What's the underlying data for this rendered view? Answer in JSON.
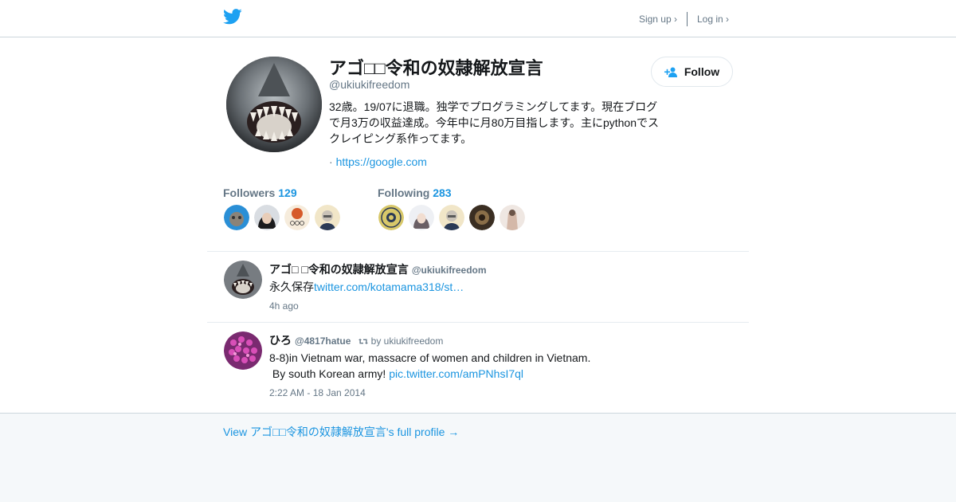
{
  "header": {
    "signup_label": "Sign up ›",
    "login_label": "Log in ›"
  },
  "profile": {
    "name": "アゴ□□令和の奴隷解放宣言",
    "handle": "@ukiukifreedom",
    "bio": "32歳。19/07に退職。独学でプログラミングしてます。現在ブログで月3万の収益達成。今年中に月80万目指します。主にpythonでスクレイピング系作ってます。",
    "link_prefix": "· ",
    "link": "https://google.com",
    "follow_label": "Follow"
  },
  "stats": {
    "followers_label": "Followers",
    "followers_count": "129",
    "following_label": "Following",
    "following_count": "283"
  },
  "tweets": [
    {
      "name": "アゴ□ □令和の奴隷解放宣言",
      "handle": "@ukiukifreedom",
      "text": "永久保存",
      "link": "twitter.com/kotamama318/st…",
      "time": "4h ago"
    },
    {
      "name": "ひろ",
      "handle": "@4817hatue",
      "retweet_by": "by ukiukifreedom",
      "text_line1": "8-8)in Vietnam war, massacre of women and children in Vietnam.",
      "text_line2": " By south Korean army! ",
      "link": "pic.twitter.com/amPNhsI7ql",
      "time": "2:22 AM - 18 Jan 2014"
    }
  ],
  "footer": {
    "full_profile_label": "View アゴ□□令和の奴隷解放宣言's full profile →"
  },
  "colors": {
    "accent": "#1b95e0",
    "twitter_blue": "#1da1f2",
    "muted": "#657786",
    "border": "#e6ecf0"
  }
}
